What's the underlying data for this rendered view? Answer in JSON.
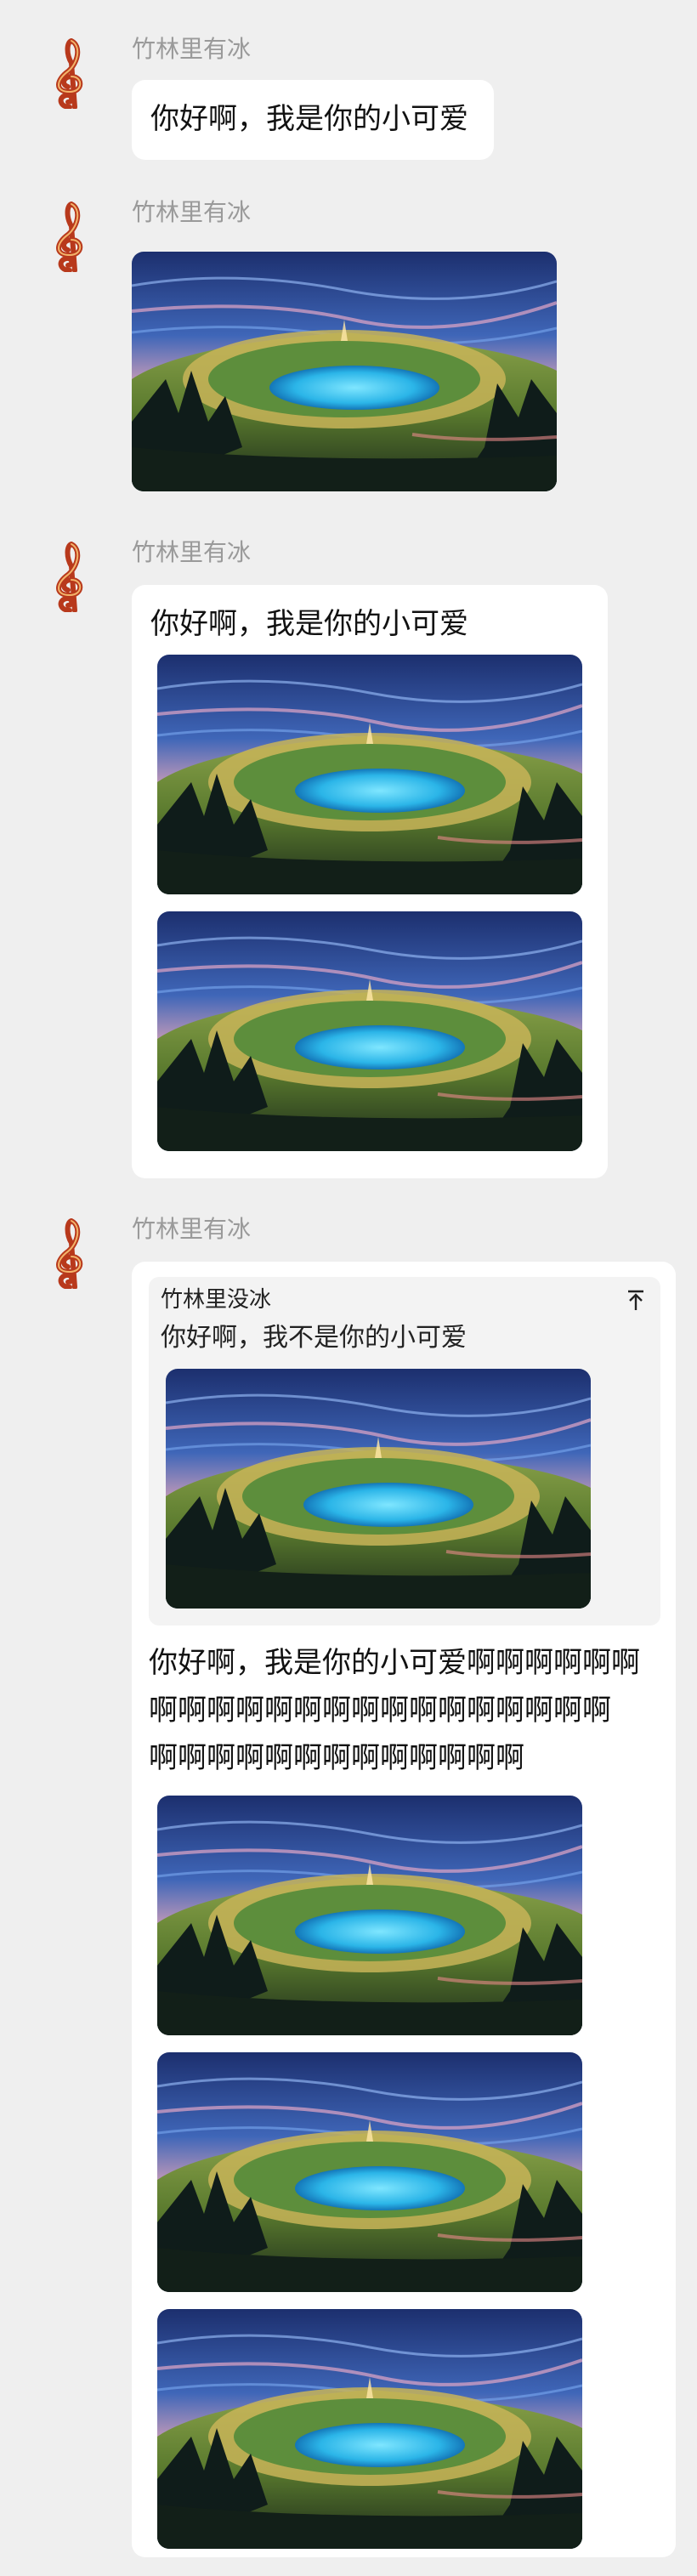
{
  "messages": [
    {
      "sender": "竹林里有冰",
      "text": "你好啊，我是你的小可爱"
    },
    {
      "sender": "竹林里有冰",
      "image_alt": "crater lake landscape"
    },
    {
      "sender": "竹林里有冰",
      "text": "你好啊，我是你的小可爱"
    },
    {
      "sender": "竹林里有冰",
      "quote": {
        "sender": "竹林里没冰",
        "text": "你好啊，我不是你的小可爱"
      },
      "text_lines": [
        "你好啊，我是你的小可爱啊啊啊啊啊啊",
        "啊啊啊啊啊啊啊啊啊啊啊啊啊啊啊啊",
        "啊啊啊啊啊啊啊啊啊啊啊啊啊"
      ]
    }
  ],
  "icons": {
    "avatar": "treble-clef-icon",
    "quote_jump": "arrow-to-top-icon"
  }
}
